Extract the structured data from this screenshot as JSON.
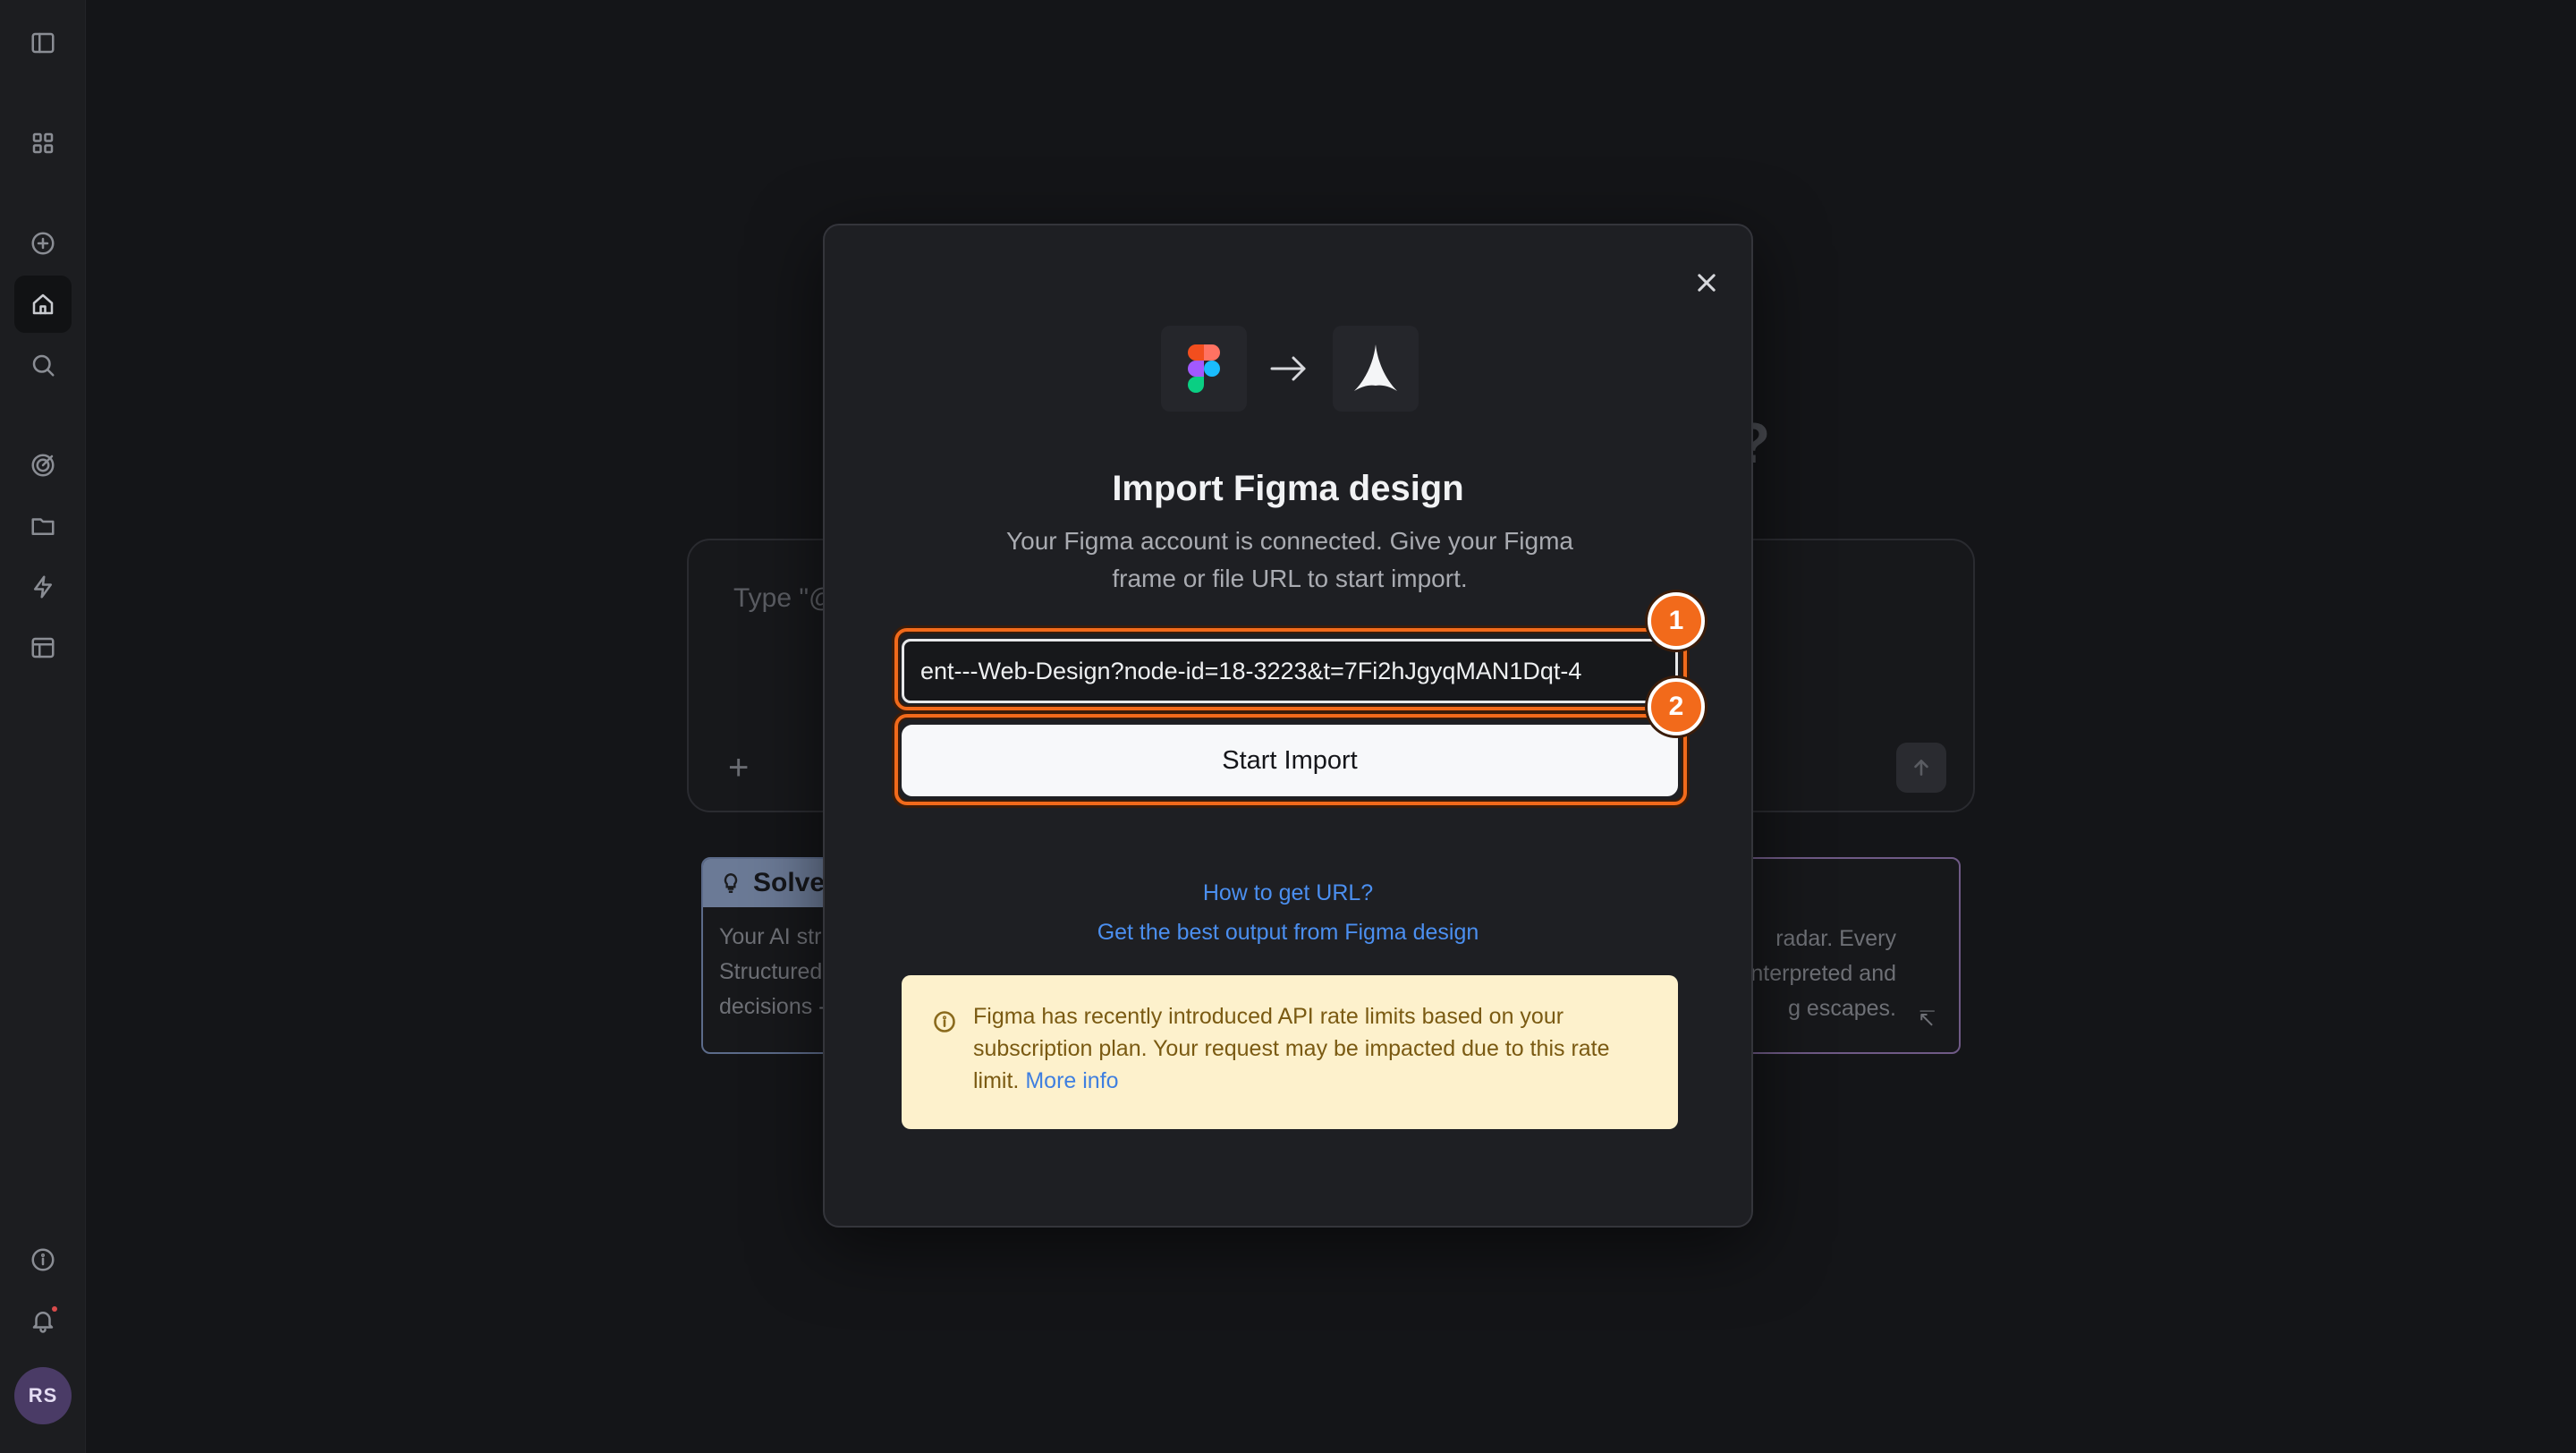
{
  "sidebar": {
    "icons": [
      "sidebar-toggle-icon",
      "grid-icon",
      "plus-circle-icon",
      "home-icon",
      "search-icon",
      "target-icon",
      "folder-icon",
      "bolt-icon",
      "layout-icon",
      "info-icon",
      "bell-icon"
    ],
    "avatar_initials": "RS"
  },
  "background": {
    "question_mark": "?",
    "composer_placeholder": "Type \"@",
    "composer_plus": "+",
    "card_left": {
      "title": "Solve",
      "lines": [
        "Your AI str",
        "Structured",
        "decisions -"
      ]
    },
    "card_right": {
      "lines": [
        "radar. Every",
        "nterpreted and",
        "g escapes."
      ],
      "corner_icon": "↸"
    }
  },
  "modal": {
    "title": "Import Figma design",
    "subtitle": "Your Figma account is connected. Give your Figma frame or file URL to start import.",
    "url_value": "ent---Web-Design?node-id=18-3223&t=7Fi2hJgyqMAN1Dqt-4",
    "start_button": "Start Import",
    "link_how_to": "How to get URL?",
    "link_best_output": "Get the best output from Figma design",
    "warning_text": "Figma has recently introduced API rate limits based on your subscription plan. Your request may be impacted due to this rate limit.",
    "warning_link": "More info",
    "step_badges": [
      "1",
      "2"
    ]
  },
  "colors": {
    "accent_orange": "#f26a1b",
    "link_blue": "#4b8ff0",
    "warning_bg": "#fdf1cc"
  }
}
